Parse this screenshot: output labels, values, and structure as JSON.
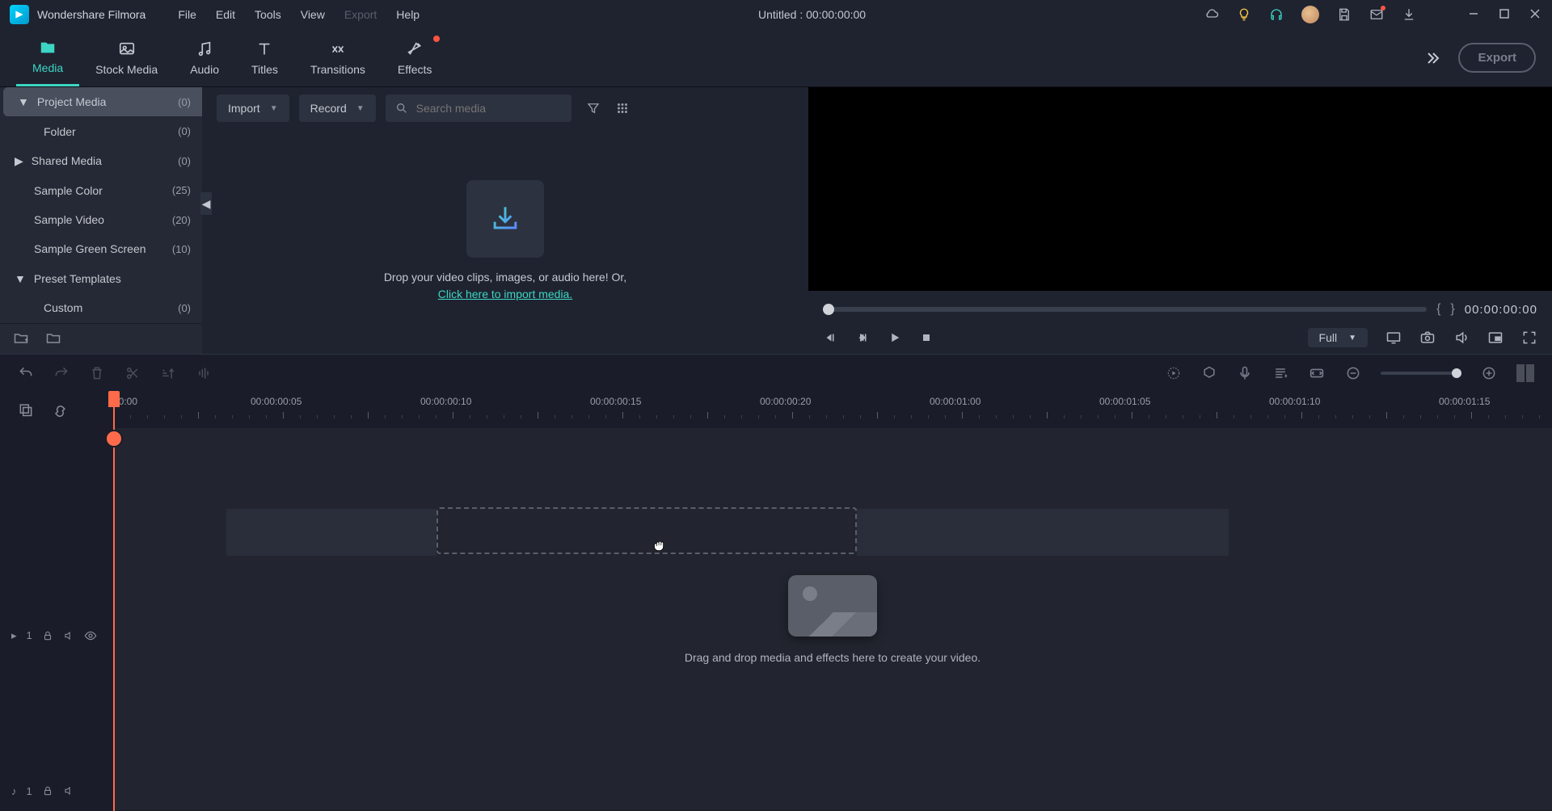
{
  "app": {
    "name": "Wondershare Filmora",
    "title": "Untitled :  00:00:00:00"
  },
  "menu": {
    "file": "File",
    "edit": "Edit",
    "tools": "Tools",
    "view": "View",
    "export": "Export",
    "help": "Help"
  },
  "tabs": {
    "media": "Media",
    "stock": "Stock Media",
    "audio": "Audio",
    "titles": "Titles",
    "transitions": "Transitions",
    "effects": "Effects"
  },
  "export_btn": "Export",
  "sidebar": {
    "items": [
      {
        "label": "Project Media",
        "count": "(0)"
      },
      {
        "label": "Folder",
        "count": "(0)"
      },
      {
        "label": "Shared Media",
        "count": "(0)"
      },
      {
        "label": "Sample Color",
        "count": "(25)"
      },
      {
        "label": "Sample Video",
        "count": "(20)"
      },
      {
        "label": "Sample Green Screen",
        "count": "(10)"
      },
      {
        "label": "Preset Templates",
        "count": ""
      },
      {
        "label": "Custom",
        "count": "(0)"
      }
    ]
  },
  "mediapane": {
    "import": "Import",
    "record": "Record",
    "search_ph": "Search media",
    "drop": "Drop your video clips, images, or audio here! Or,",
    "link": "Click here to import media."
  },
  "preview": {
    "timecode": "00:00:00:00",
    "quality": "Full"
  },
  "timeline": {
    "ticks": [
      "00:00",
      "00:00:00:05",
      "00:00:00:10",
      "00:00:00:15",
      "00:00:00:20",
      "00:00:01:00",
      "00:00:01:05",
      "00:00:01:10",
      "00:00:01:15"
    ],
    "hint": "Drag and drop media and effects here to create your video.",
    "videoTrack": "1",
    "audioTrack": "1"
  }
}
